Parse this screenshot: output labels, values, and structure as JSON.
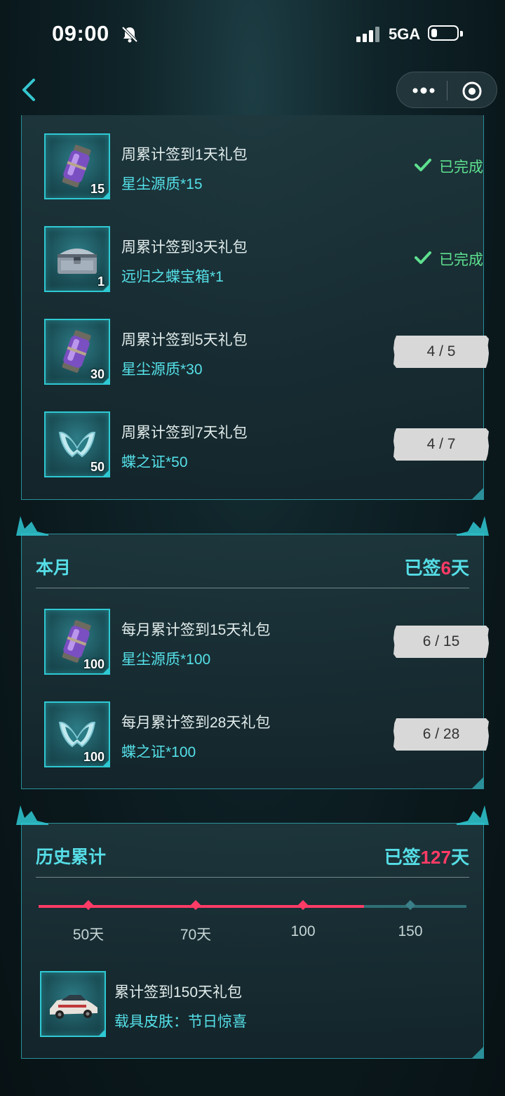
{
  "status": {
    "time": "09:00",
    "network": "5GA"
  },
  "weekly": {
    "items": [
      {
        "title": "周累计签到1天礼包",
        "reward": "星尘源质*15",
        "count": "15",
        "icon": "stardust-canister-icon",
        "status": "已完成"
      },
      {
        "title": "周累计签到3天礼包",
        "reward": "远归之蝶宝箱*1",
        "count": "1",
        "icon": "treasure-chest-icon",
        "status": "已完成"
      },
      {
        "title": "周累计签到5天礼包",
        "reward": "星尘源质*30",
        "count": "30",
        "icon": "stardust-canister-icon",
        "progress": "4 / 5"
      },
      {
        "title": "周累计签到7天礼包",
        "reward": "蝶之证*50",
        "count": "50",
        "icon": "butterfly-token-icon",
        "progress": "4 / 7"
      }
    ]
  },
  "monthly": {
    "title": "本月",
    "signed_prefix": "已签",
    "signed_days": "6",
    "signed_suffix": "天",
    "items": [
      {
        "title": "每月累计签到15天礼包",
        "reward": "星尘源质*100",
        "count": "100",
        "icon": "stardust-canister-icon",
        "progress": "6 / 15"
      },
      {
        "title": "每月累计签到28天礼包",
        "reward": "蝶之证*100",
        "count": "100",
        "icon": "butterfly-token-icon",
        "progress": "6 / 28"
      }
    ]
  },
  "history": {
    "title": "历史累计",
    "signed_prefix": "已签",
    "signed_days": "127",
    "signed_suffix": "天",
    "milestones": [
      "50天",
      "70天",
      "100",
      "150"
    ],
    "progress_fraction": 0.76,
    "reward": {
      "title": "累计签到150天礼包",
      "desc": "载具皮肤：节日惊喜",
      "icon": "vehicle-skin-car-icon"
    }
  },
  "colors": {
    "accent": "#56dde6",
    "highlight": "#ff3b66",
    "done": "#5ee08f"
  }
}
